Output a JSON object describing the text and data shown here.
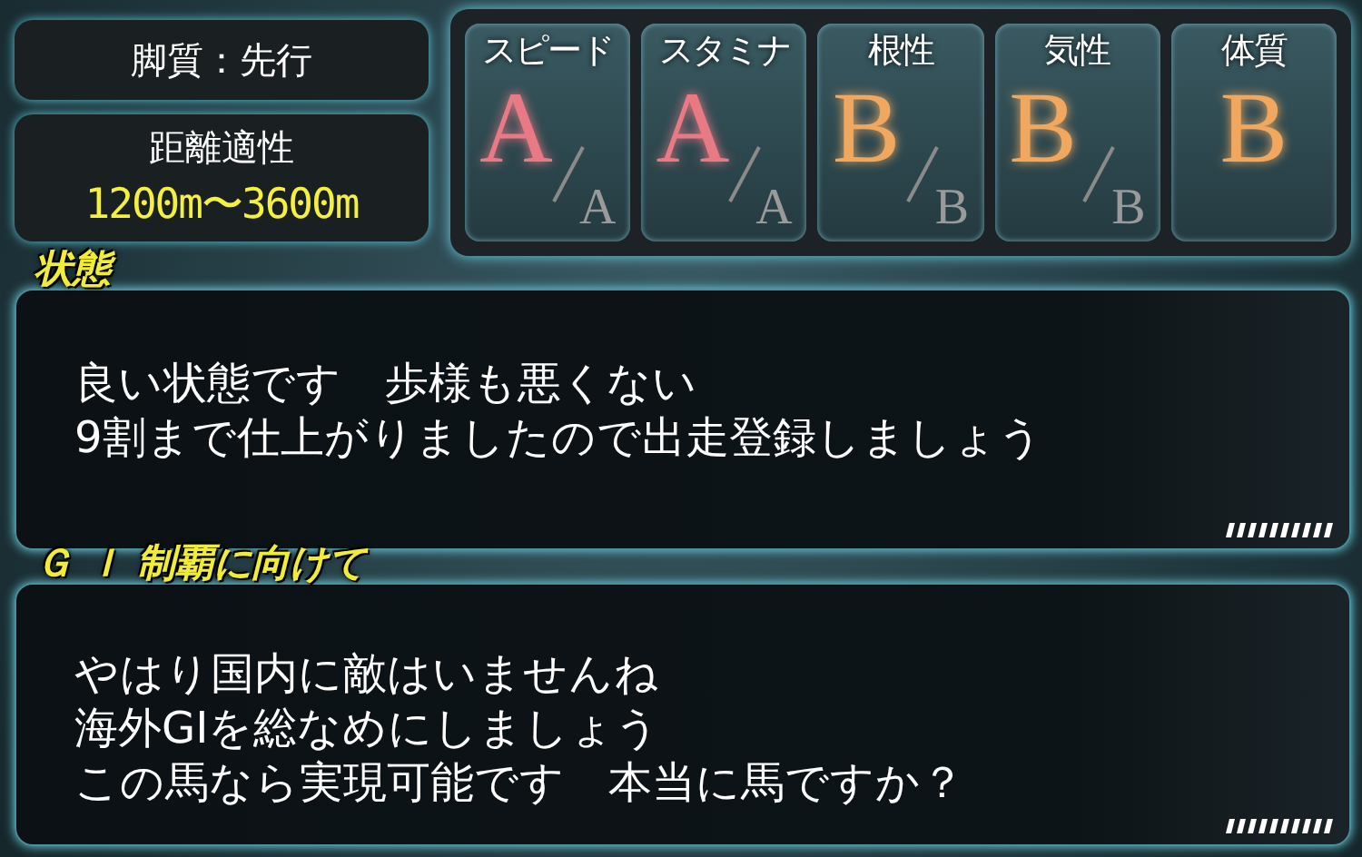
{
  "style_box": {
    "text": "脚質：先行"
  },
  "distance_box": {
    "label": "距離適性",
    "value": "1200m〜3600m"
  },
  "stats": [
    {
      "name": "スピード",
      "grade": "A",
      "potential": "A",
      "color": "#e87a86"
    },
    {
      "name": "スタミナ",
      "grade": "A",
      "potential": "A",
      "color": "#e87a86"
    },
    {
      "name": "根性",
      "grade": "B",
      "potential": "B",
      "color": "#f0a860"
    },
    {
      "name": "気性",
      "grade": "B",
      "potential": "B",
      "color": "#f0a860"
    },
    {
      "name": "体質",
      "grade": "B",
      "color": "#f0a860"
    }
  ],
  "panels": [
    {
      "title": "状態",
      "lines": [
        "良い状態です　歩様も悪くない",
        "9割まで仕上がりましたので出走登録しましょう"
      ]
    },
    {
      "title": "Ｇ Ｉ 制覇に向けて",
      "lines": [
        "やはり国内に敵はいませんね",
        "海外GIを総なめにしましょう",
        "この馬なら実現可能です　本当に馬ですか？"
      ]
    }
  ]
}
